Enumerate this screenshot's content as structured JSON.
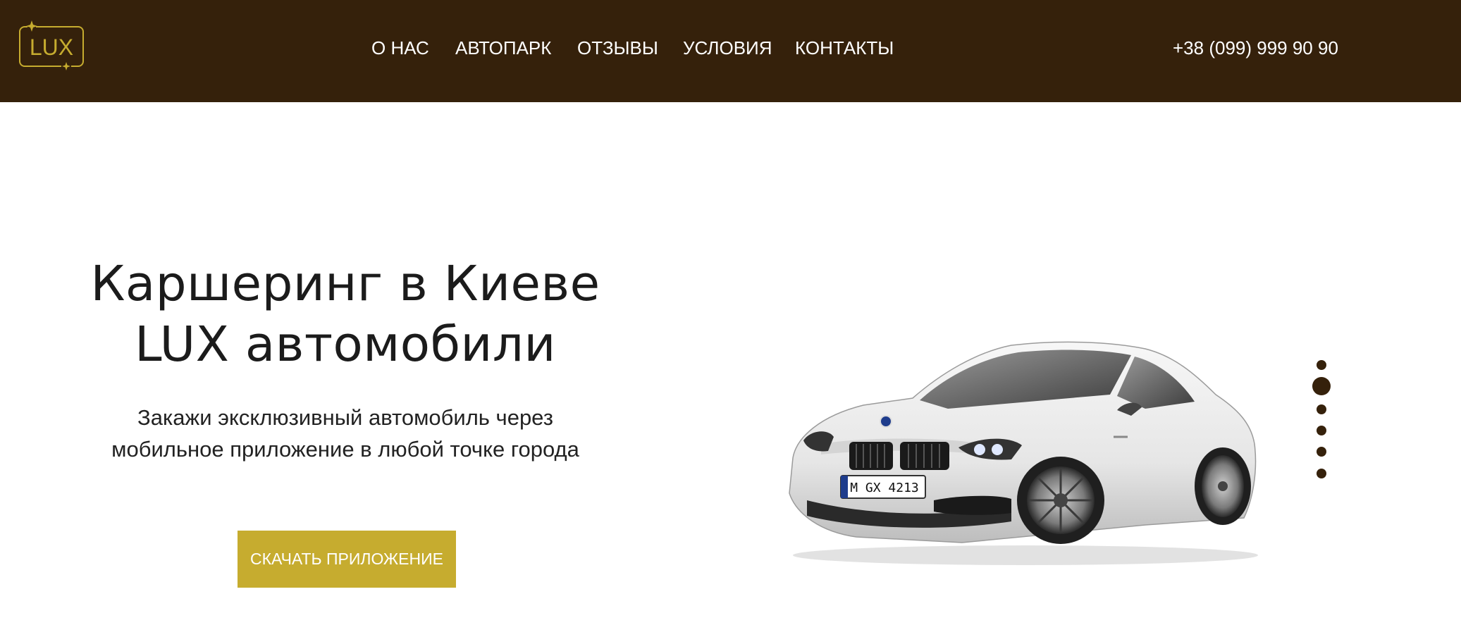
{
  "header": {
    "logo_text": "LUX",
    "nav": [
      {
        "label": "О НАС"
      },
      {
        "label": "АВТОПАРК"
      },
      {
        "label": "ОТЗЫВЫ"
      },
      {
        "label": "УСЛОВИЯ"
      },
      {
        "label": "КОНТАКТЫ"
      }
    ],
    "phone": "+38 (099) 999 90 90"
  },
  "hero": {
    "title_line1": "Каршеринг в Киеве",
    "title_line2": "LUX автомобили",
    "subtitle_line1": "Закажи эксклюзивный автомобиль через",
    "subtitle_line2": "мобильное приложение в любой точке города",
    "cta_label": "СКАЧАТЬ ПРИЛОЖЕНИЕ",
    "car_plate": "M GX 4213"
  },
  "slider": {
    "total": 6,
    "active_index": 1
  },
  "colors": {
    "header_bg": "#35210b",
    "accent": "#c6ac2f",
    "text_dark": "#1b1b1b"
  }
}
